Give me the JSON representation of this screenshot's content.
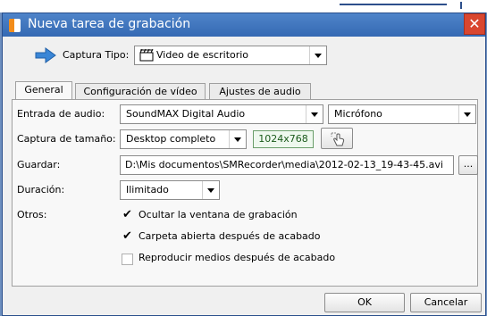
{
  "window": {
    "title": "Nueva tarea de grabación",
    "close_glyph": "✕"
  },
  "capture_type": {
    "label": "Captura Tipo:",
    "value": "Video de escritorio"
  },
  "tabs": [
    {
      "label": "General",
      "active": true
    },
    {
      "label": "Configuración de vídeo",
      "active": false
    },
    {
      "label": "Ajustes de audio",
      "active": false
    }
  ],
  "general": {
    "audio_input": {
      "label": "Entrada de audio:",
      "device": "SoundMAX Digital Audio",
      "source": "Micrófono"
    },
    "capture_size": {
      "label": "Captura de tamaño:",
      "value": "Desktop completo",
      "resolution": "1024x768"
    },
    "save": {
      "label": "Guardar:",
      "path": "D:\\Mis documentos\\SMRecorder\\media\\2012-02-13_19-43-45.avi",
      "browse_label": "..."
    },
    "duration": {
      "label": "Duración:",
      "value": "Ilimitado"
    },
    "others": {
      "label": "Otros:",
      "options": [
        {
          "label": "Ocultar la ventana de grabación",
          "checked": true
        },
        {
          "label": "Carpeta abierta después de acabado",
          "checked": true
        },
        {
          "label": "Reproducir medios después de acabado",
          "checked": false
        }
      ]
    }
  },
  "footer": {
    "ok_label": "OK",
    "cancel_label": "Cancelar"
  },
  "icons": {
    "app": "recorder-app-icon",
    "arrow": "right-arrow-icon",
    "film": "film-clapper-icon",
    "select_region": "hand-select-icon",
    "dropdown": "chevron-down-icon"
  }
}
